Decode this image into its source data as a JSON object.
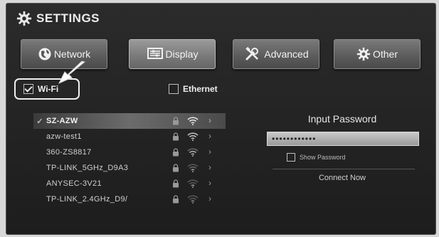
{
  "header": {
    "title": "SETTINGS"
  },
  "tabs": [
    {
      "label": "Network",
      "icon": "globe-icon"
    },
    {
      "label": "Display",
      "icon": "display-icon"
    },
    {
      "label": "Advanced",
      "icon": "tools-icon"
    },
    {
      "label": "Other",
      "icon": "gear-icon"
    }
  ],
  "connection_types": {
    "wifi": {
      "label": "Wi-Fi",
      "checked": true
    },
    "ethernet": {
      "label": "Ethernet",
      "checked": false
    }
  },
  "networks": [
    {
      "ssid": "SZ-AZW",
      "selected": true,
      "locked": true
    },
    {
      "ssid": "azw-test1",
      "selected": false,
      "locked": true
    },
    {
      "ssid": "360-ZS8817",
      "selected": false,
      "locked": true
    },
    {
      "ssid": "TP-LINK_5GHz_D9A3",
      "selected": false,
      "locked": true
    },
    {
      "ssid": "ANYSEC-3V21",
      "selected": false,
      "locked": true
    },
    {
      "ssid": "TP-LINK_2.4GHz_D9/",
      "selected": false,
      "locked": true
    }
  ],
  "password_panel": {
    "title": "Input Password",
    "password_value": "••••••••••••",
    "show_password_label": "Show Password",
    "connect_label": "Connect Now"
  },
  "colors": {
    "background": "#222222",
    "text": "#e6e6e6",
    "accent": "#7b7b7b"
  }
}
